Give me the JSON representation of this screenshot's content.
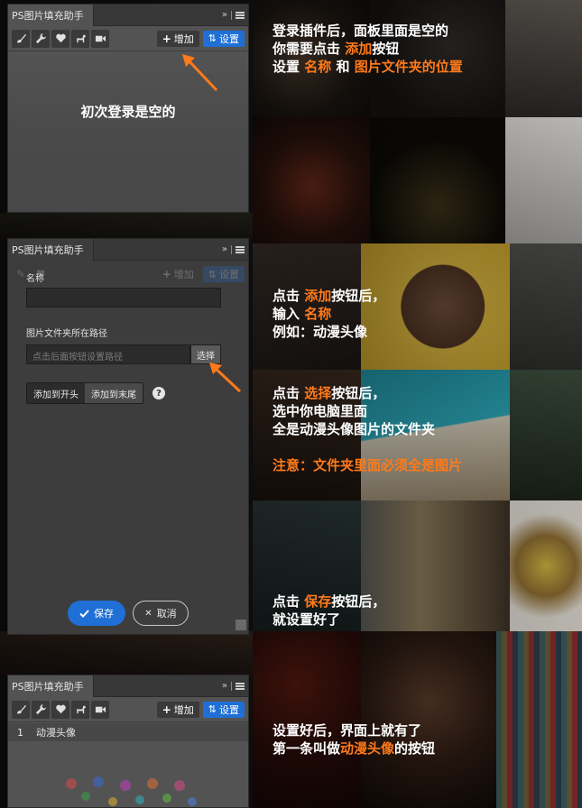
{
  "panel_title": "PS图片填充助手",
  "toolbar": {
    "add_label": "增加",
    "settings_label": "设置"
  },
  "panel1": {
    "empty_message": "初次登录是空的"
  },
  "panel2": {
    "name_label": "名称",
    "path_label": "图片文件夹所在路径",
    "path_placeholder": "点击后面按钮设置路径",
    "choose_button": "选择",
    "add_to_start": "添加到开头",
    "add_to_end": "添加到末尾",
    "help_symbol": "?",
    "save_button": "保存",
    "cancel_button": "取消"
  },
  "panel3": {
    "row_index": "1",
    "row_name": "动漫头像"
  },
  "instructions": {
    "block1": {
      "line1": "登录插件后，面板里面是空的",
      "line2_a": "你需要点击 ",
      "line2_hl": "添加",
      "line2_b": "按钮",
      "line3_a": "设置 ",
      "line3_hl1": "名称",
      "line3_b": " 和 ",
      "line3_hl2": "图片文件夹的位置"
    },
    "block2": {
      "line1_a": "点击 ",
      "line1_hl": "添加",
      "line1_b": "按钮后，",
      "line2_a": "输入 ",
      "line2_hl": "名称",
      "line3": "例如：动漫头像"
    },
    "block3": {
      "line1_a": "点击 ",
      "line1_hl": "选择",
      "line1_b": "按钮后，",
      "line2": "选中你电脑里面",
      "line3": "全是动漫头像图片的文件夹",
      "note": "注意：文件夹里面必须全是图片"
    },
    "block4": {
      "line1_a": "点击 ",
      "line1_hl": "保存",
      "line1_b": "按钮后，",
      "line2": "就设置好了"
    },
    "block5": {
      "line1": "设置好后，界面上就有了",
      "line2_a": "第一条叫做",
      "line2_hl": "动漫头像",
      "line2_b": "的按钮"
    }
  },
  "colors": {
    "accent_orange": "#ff7a1a",
    "button_blue": "#1f6fd6",
    "panel_gray": "#535353"
  },
  "icons": [
    "brush-icon",
    "wrench-icon",
    "heart-icon",
    "dog-icon",
    "video-icon",
    "checkmark-icon",
    "x-icon",
    "double-chevron-icon",
    "menu-icon",
    "sort-icon"
  ]
}
